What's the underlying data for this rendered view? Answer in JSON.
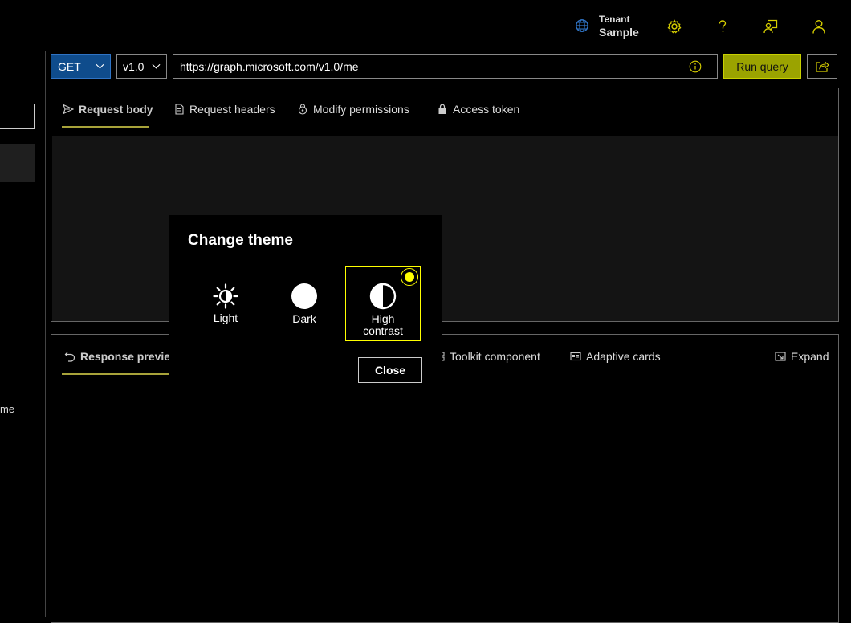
{
  "colors": {
    "accent": "#9ba300",
    "method_bg": "#0f4c8c",
    "highlight": "#ffff00",
    "tab_underline": "#a8a33a"
  },
  "header": {
    "tenant_label": "Tenant",
    "tenant_name": "Sample",
    "icons": [
      "globe-icon",
      "gear-icon",
      "help-icon",
      "feedback-icon",
      "person-icon"
    ]
  },
  "sidebar": {
    "truncated_item": "me"
  },
  "query": {
    "method": "GET",
    "version": "v1.0",
    "url": "https://graph.microsoft.com/v1.0/me",
    "run_label": "Run query"
  },
  "request_tabs": {
    "request_body": "Request body",
    "request_headers": "Request headers",
    "modify_permissions": "Modify permissions",
    "access_token": "Access token"
  },
  "response_tabs": {
    "response_preview": "Response preview",
    "toolkit_component": "Toolkit component",
    "adaptive_cards": "Adaptive cards",
    "expand": "Expand"
  },
  "modal": {
    "title": "Change theme",
    "options": {
      "light": "Light",
      "dark": "Dark",
      "hc_line1": "High",
      "hc_line2": "contrast"
    },
    "selected": "High contrast",
    "close_label": "Close"
  }
}
